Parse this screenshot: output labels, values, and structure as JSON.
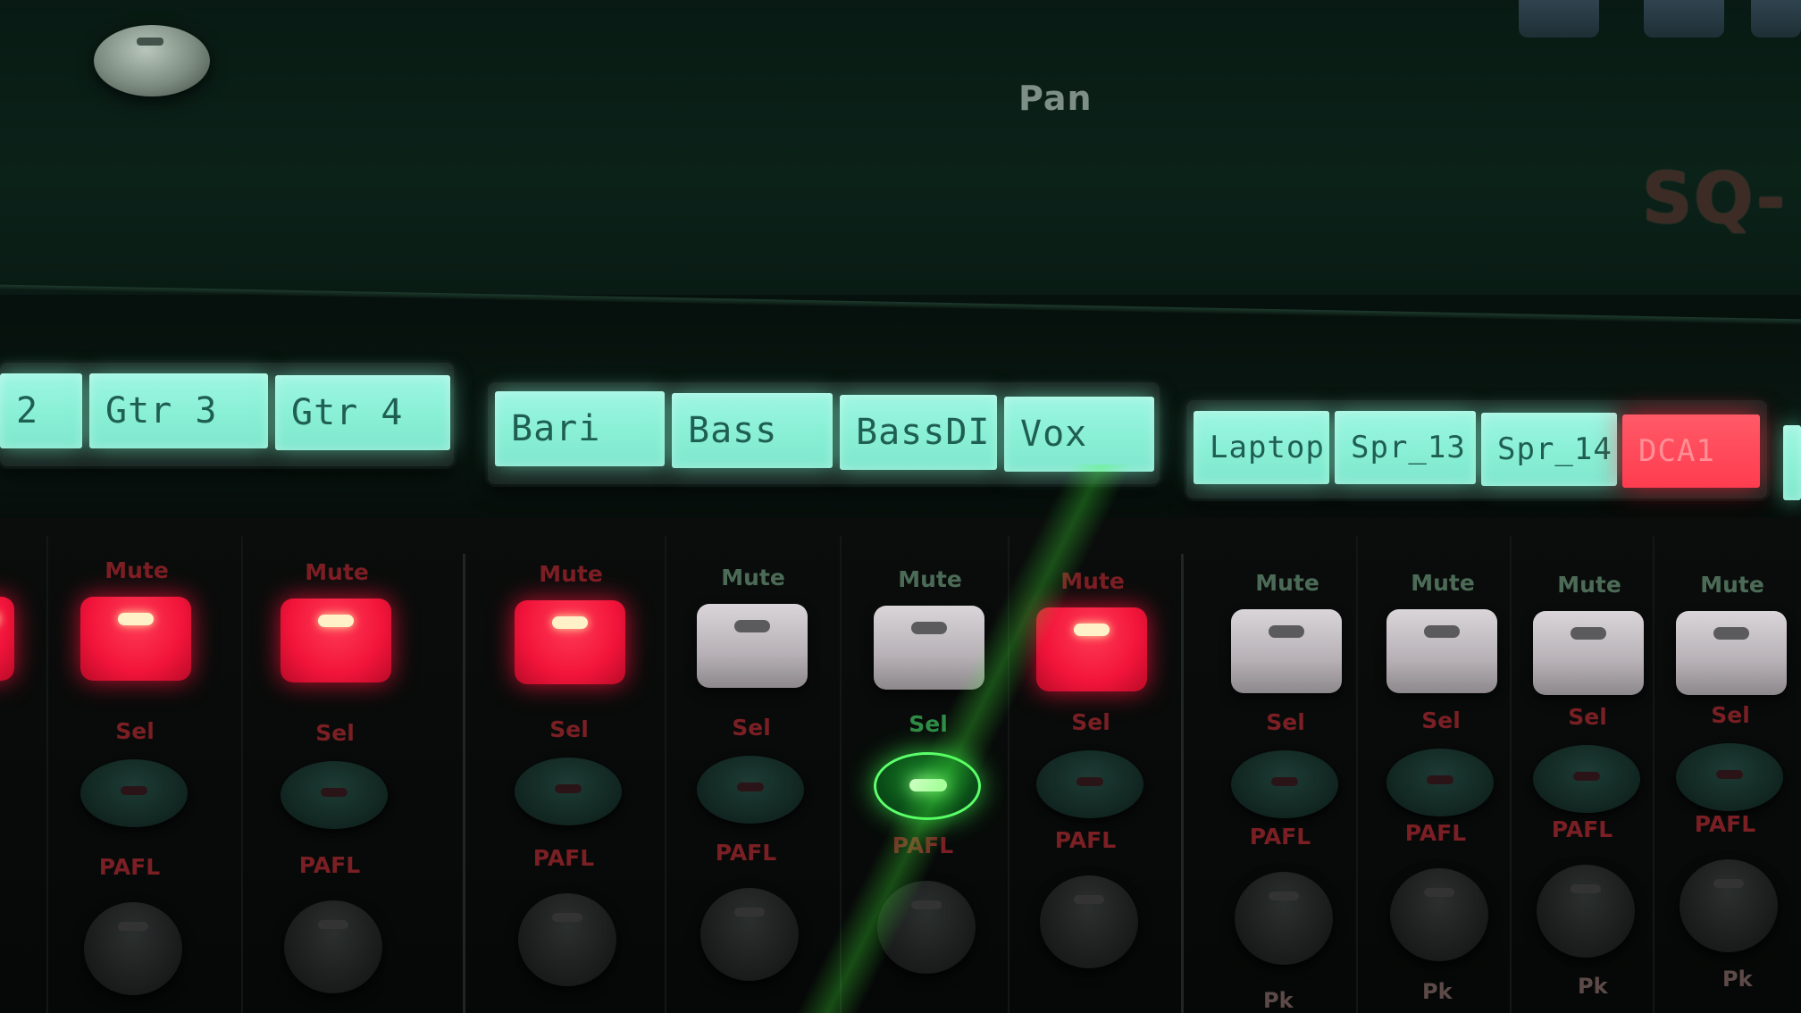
{
  "panel": {
    "pan_label": "Pan",
    "brand_text": "SQ-"
  },
  "lcd_bank_1": [
    "2",
    "Gtr 3",
    "Gtr 4"
  ],
  "lcd_bank_2": [
    "Bari",
    "Bass",
    "BassDI",
    "Vox"
  ],
  "lcd_bank_3": [
    "Laptop",
    "Spr_13",
    "Spr_14",
    "DCA1"
  ],
  "channels": [
    {
      "mute_label": "Mute",
      "mute_state": "on",
      "sel_label": "Sel",
      "sel_state": "off",
      "pafl_label": "PAFL"
    },
    {
      "mute_label": "Mute",
      "mute_state": "on",
      "sel_label": "Sel",
      "sel_state": "off",
      "pafl_label": "PAFL"
    },
    {
      "mute_label": "Mute",
      "mute_state": "on",
      "sel_label": "Sel",
      "sel_state": "off",
      "pafl_label": "PAFL"
    },
    {
      "mute_label": "Mute",
      "mute_state": "off",
      "sel_label": "Sel",
      "sel_state": "off",
      "pafl_label": "PAFL"
    },
    {
      "mute_label": "Mute",
      "mute_state": "off",
      "sel_label": "Sel",
      "sel_state": "on",
      "pafl_label": "PAFL"
    },
    {
      "mute_label": "Mute",
      "mute_state": "on",
      "sel_label": "Sel",
      "sel_state": "off",
      "pafl_label": "PAFL"
    },
    {
      "mute_label": "Mute",
      "mute_state": "off",
      "sel_label": "Sel",
      "sel_state": "off",
      "pafl_label": "PAFL"
    },
    {
      "mute_label": "Mute",
      "mute_state": "off",
      "sel_label": "Sel",
      "sel_state": "off",
      "pafl_label": "PAFL"
    },
    {
      "mute_label": "Mute",
      "mute_state": "off",
      "sel_label": "Sel",
      "sel_state": "off",
      "pafl_label": "PAFL"
    },
    {
      "mute_label": "Mute",
      "mute_state": "off",
      "sel_label": "Sel",
      "sel_state": "off",
      "pafl_label": "PAFL"
    }
  ],
  "pk_label": "Pk",
  "colors": {
    "lcd_cyan": "#8af0d6",
    "lcd_red": "#ff3c4f",
    "mute_on": "#f2143a",
    "mute_off": "#b7b1b6",
    "sel_on": "#5cff6c"
  }
}
